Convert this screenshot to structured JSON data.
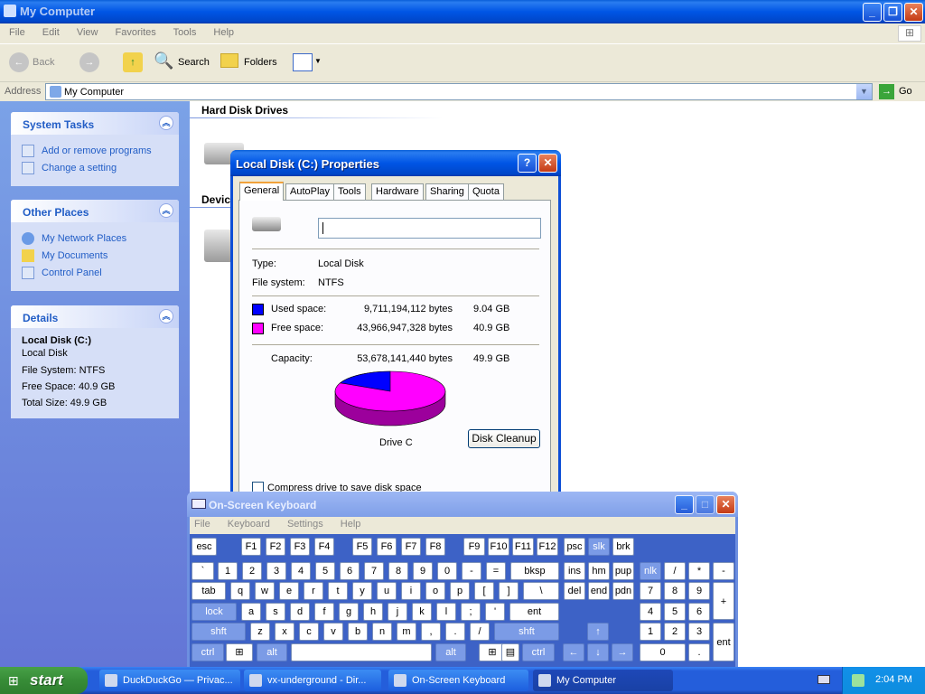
{
  "window": {
    "title": "My Computer",
    "menu": [
      "File",
      "Edit",
      "View",
      "Favorites",
      "Tools",
      "Help"
    ],
    "toolbar": {
      "back": "Back",
      "search": "Search",
      "folders": "Folders"
    },
    "address": {
      "label": "Address",
      "value": "My Computer",
      "go": "Go"
    }
  },
  "sidebar": {
    "system_tasks": {
      "title": "System Tasks",
      "items": [
        "Add or remove programs",
        "Change a setting"
      ]
    },
    "other_places": {
      "title": "Other Places",
      "items": [
        "My Network Places",
        "My Documents",
        "Control Panel"
      ]
    },
    "details": {
      "title": "Details",
      "name": "Local Disk (C:)",
      "type": "Local Disk",
      "fs": "File System: NTFS",
      "free": "Free Space: 40.9 GB",
      "total": "Total Size: 49.9 GB"
    }
  },
  "content": {
    "section1": "Hard Disk Drives",
    "section2": "Devic"
  },
  "dialog": {
    "title": "Local Disk (C:) Properties",
    "tabs": [
      "General",
      "AutoPlay",
      "Tools",
      "Hardware",
      "Sharing",
      "Quota"
    ],
    "label_value": "",
    "type_label": "Type:",
    "type_value": "Local Disk",
    "fs_label": "File system:",
    "fs_value": "NTFS",
    "used_label": "Used space:",
    "used_bytes": "9,711,194,112 bytes",
    "used_gb": "9.04 GB",
    "free_label": "Free space:",
    "free_bytes": "43,966,947,328 bytes",
    "free_gb": "40.9 GB",
    "cap_label": "Capacity:",
    "cap_bytes": "53,678,141,440 bytes",
    "cap_gb": "49.9 GB",
    "drive_label": "Drive C",
    "cleanup": "Disk Cleanup",
    "compress": "Compress drive to save disk space",
    "used_fraction": 0.181,
    "used_color": "#0000ff",
    "free_color": "#ff00ff"
  },
  "osk": {
    "title": "On-Screen Keyboard",
    "menu": [
      "File",
      "Keyboard",
      "Settings",
      "Help"
    ],
    "row0": [
      "esc",
      "F1",
      "F2",
      "F3",
      "F4",
      "F5",
      "F6",
      "F7",
      "F8",
      "F9",
      "F10",
      "F11",
      "F12",
      "psc",
      "slk",
      "brk"
    ],
    "row1": [
      "`",
      "1",
      "2",
      "3",
      "4",
      "5",
      "6",
      "7",
      "8",
      "9",
      "0",
      "-",
      "=",
      "bksp",
      "ins",
      "hm",
      "pup",
      "nlk",
      "/",
      "*",
      "-"
    ],
    "row2": [
      "tab",
      "q",
      "w",
      "e",
      "r",
      "t",
      "y",
      "u",
      "i",
      "o",
      "p",
      "[",
      "]",
      "\\",
      "del",
      "end",
      "pdn",
      "7",
      "8",
      "9",
      "+"
    ],
    "row3": [
      "lock",
      "a",
      "s",
      "d",
      "f",
      "g",
      "h",
      "j",
      "k",
      "l",
      ";",
      "'",
      "ent",
      "4",
      "5",
      "6"
    ],
    "row4": [
      "shft",
      "z",
      "x",
      "c",
      "v",
      "b",
      "n",
      "m",
      ",",
      ".",
      "/",
      "shft",
      "↑",
      "1",
      "2",
      "3",
      "ent"
    ],
    "row5": [
      "ctrl",
      "alt",
      "alt",
      "ctrl",
      "←",
      "↓",
      "→",
      "0",
      "."
    ]
  },
  "taskbar": {
    "start": "start",
    "items": [
      "DuckDuckGo — Privac...",
      "vx-underground - Dir...",
      "On-Screen Keyboard",
      "My Computer"
    ],
    "clock": "2:04 PM"
  }
}
